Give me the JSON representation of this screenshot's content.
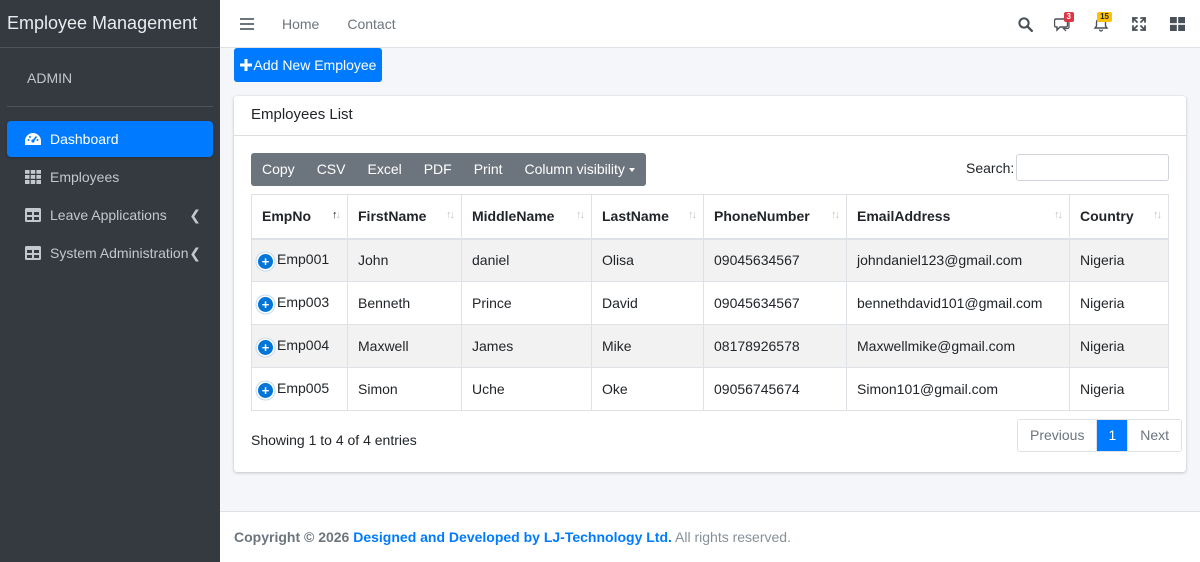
{
  "sidebar": {
    "brand": "Employee Management",
    "user": "ADMIN",
    "items": [
      {
        "label": "Dashboard",
        "icon": "tachometer-icon"
      },
      {
        "label": "Employees",
        "icon": "grid-icon"
      },
      {
        "label": "Leave Applications",
        "icon": "table-icon"
      },
      {
        "label": "System Administration",
        "icon": "table-icon"
      }
    ]
  },
  "topbar": {
    "links": [
      "Home",
      "Contact"
    ],
    "messages_count": "3",
    "notifications_count": "15"
  },
  "content": {
    "add_button": "Add New Employee",
    "card_title": "Employees List",
    "toolbar": [
      "Copy",
      "CSV",
      "Excel",
      "PDF",
      "Print",
      "Column visibility"
    ],
    "search_label": "Search:",
    "search_value": "",
    "columns": [
      "EmpNo",
      "FirstName",
      "MiddleName",
      "LastName",
      "PhoneNumber",
      "EmailAddress",
      "Country"
    ],
    "rows": [
      [
        "Emp001",
        "John",
        "daniel",
        "Olisa",
        "09045634567",
        "johndaniel123@gmail.com",
        "Nigeria"
      ],
      [
        "Emp003",
        "Benneth",
        "Prince",
        "David",
        "09045634567",
        "bennethdavid101@gmail.com",
        "Nigeria"
      ],
      [
        "Emp004",
        "Maxwell",
        "James",
        "Mike",
        "08178926578",
        "Maxwellmike@gmail.com",
        "Nigeria"
      ],
      [
        "Emp005",
        "Simon",
        "Uche",
        "Oke",
        "09056745674",
        "Simon101@gmail.com",
        "Nigeria"
      ]
    ],
    "info": "Showing 1 to 4 of 4 entries",
    "pager": {
      "prev": "Previous",
      "current": "1",
      "next": "Next"
    }
  },
  "footer": {
    "copyright": "Copyright © 2026",
    "credit": "Designed and Developed by LJ-Technology Ltd.",
    "rights": "All rights reserved."
  },
  "colors": {
    "primary": "#007bff",
    "sidebar": "#343a40",
    "toolbar": "#6c757d"
  }
}
